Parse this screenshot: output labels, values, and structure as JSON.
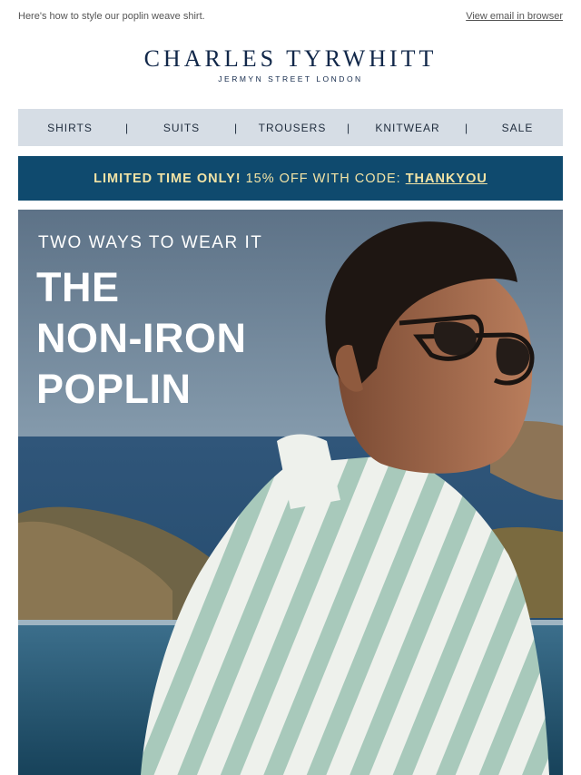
{
  "preheader": {
    "text": "Here's how to style our poplin weave shirt.",
    "view_in_browser": "View email in browser"
  },
  "logo": {
    "brand": "CHARLES TYRWHITT",
    "tagline": "JERMYN STREET LONDON"
  },
  "nav": {
    "items": [
      {
        "label": "SHIRTS"
      },
      {
        "label": "SUITS"
      },
      {
        "label": "TROUSERS"
      },
      {
        "label": "KNITWEAR"
      },
      {
        "label": "SALE"
      }
    ],
    "separator": "|"
  },
  "promo": {
    "lead": "LIMITED TIME ONLY!",
    "offer": "15% OFF WITH CODE:",
    "code": "THANKYOU"
  },
  "hero": {
    "eyebrow": "TWO WAYS TO WEAR IT",
    "headline_lines": [
      "THE",
      "NON-IRON",
      "POPLIN"
    ]
  },
  "colors": {
    "brand_navy": "#12284a",
    "nav_background": "#d6dde5",
    "promo_background": "#0f4a6e",
    "promo_text": "#f2e3a5"
  }
}
